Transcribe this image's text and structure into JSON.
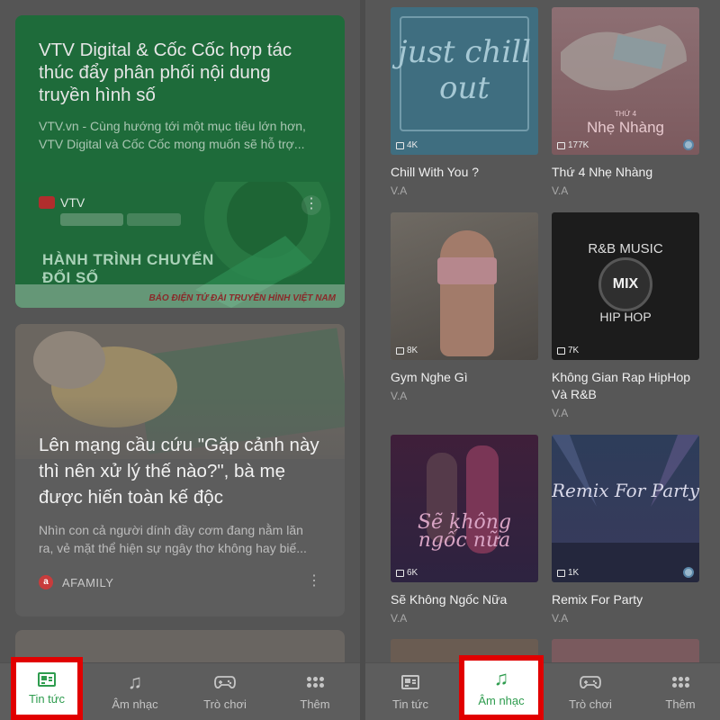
{
  "left_screen": {
    "news": [
      {
        "title": "VTV Digital & Cốc Cốc hợp tác thúc đẩy phân phối nội dung truyền hình số",
        "description": "VTV.vn - Cùng hướng tới một mục tiêu lớn hơn, VTV Digital và Cốc Cốc mong muốn sẽ hỗ trợ...",
        "source": "VTV",
        "banner_text": "HÀNH TRÌNH CHUYỂN ĐỔI SỐ",
        "footer_text": "BÁO ĐIỆN TỬ ĐÀI TRUYỀN HÌNH VIỆT NAM"
      },
      {
        "title": "Lên mạng cầu cứu \"Gặp cảnh này thì nên xử lý thế nào?\", bà mẹ được hiến toàn kế độc",
        "description": "Nhìn con cả người dính đầy cơm đang nằm lăn ra, vẻ mặt thể hiện sự ngây thơ không hay biế...",
        "source": "AFAMILY"
      }
    ],
    "more_icon": "⋮",
    "nav": [
      {
        "label": "Tin tức",
        "icon": "news-icon",
        "active": true
      },
      {
        "label": "Âm nhạc",
        "icon": "music-note-icon",
        "active": false
      },
      {
        "label": "Trò chơi",
        "icon": "gamepad-icon",
        "active": false
      },
      {
        "label": "Thêm",
        "icon": "more-grid-icon",
        "active": false
      }
    ]
  },
  "right_screen": {
    "albums": [
      {
        "title": "Chill With You ?",
        "artist": "V.A",
        "count": "4K",
        "cover_text": "just chill out"
      },
      {
        "title": "Thứ 4 Nhẹ Nhàng",
        "artist": "V.A",
        "count": "177K",
        "cover_small": "THỨ 4",
        "cover_text": "Nhẹ Nhàng"
      },
      {
        "title": "Gym Nghe Gì",
        "artist": "V.A",
        "count": "8K"
      },
      {
        "title": "Không Gian Rap HipHop Và R&B",
        "artist": "V.A",
        "count": "7K",
        "cover_text": "R&B MUSIC",
        "cover_disc": "MIX",
        "cover_text2": "HIP HOP"
      },
      {
        "title": "Sẽ Không Ngốc Nữa",
        "artist": "V.A",
        "count": "6K",
        "cover_text": "Sẽ không ngốc nữa"
      },
      {
        "title": "Remix For Party",
        "artist": "V.A",
        "count": "1K",
        "cover_text": "Remix For Party"
      }
    ],
    "nav": [
      {
        "label": "Tin tức",
        "icon": "news-icon",
        "active": false
      },
      {
        "label": "Âm nhạc",
        "icon": "music-note-icon",
        "active": true
      },
      {
        "label": "Trò chơi",
        "icon": "gamepad-icon",
        "active": false
      },
      {
        "label": "Thêm",
        "icon": "more-grid-icon",
        "active": false
      }
    ]
  },
  "colors": {
    "highlight_border": "#e10000",
    "active_green": "#2e9c4e"
  }
}
